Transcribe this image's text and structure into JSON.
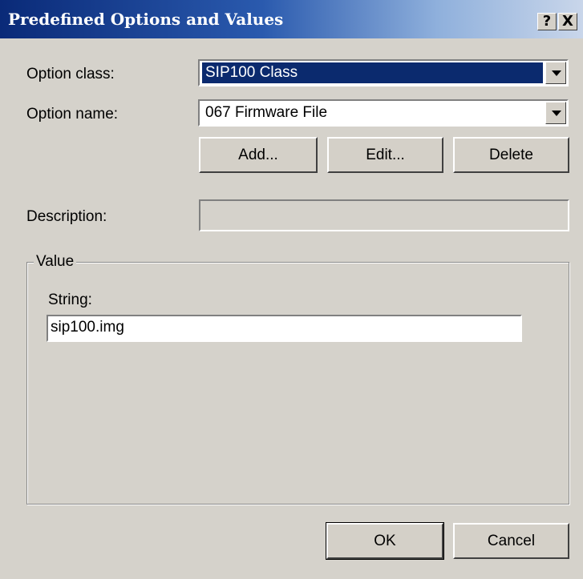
{
  "window": {
    "title": "Predefined Options and Values",
    "help_button": "?",
    "close_button": "X"
  },
  "option_class": {
    "label": "Option class:",
    "value": "SIP100 Class"
  },
  "option_name": {
    "label": "Option name:",
    "value": "067 Firmware File"
  },
  "actions": {
    "add": "Add...",
    "edit": "Edit...",
    "delete": "Delete"
  },
  "description": {
    "label": "Description:",
    "value": ""
  },
  "value_group": {
    "legend": "Value",
    "string_label": "String:",
    "string_value": "sip100.img"
  },
  "footer": {
    "ok": "OK",
    "cancel": "Cancel"
  },
  "colors": {
    "title_bar_start": "#0a2a78",
    "title_bar_end": "#c9d6ea",
    "dialog_face": "#d5d2cb",
    "selection": "#0b2a6e"
  }
}
